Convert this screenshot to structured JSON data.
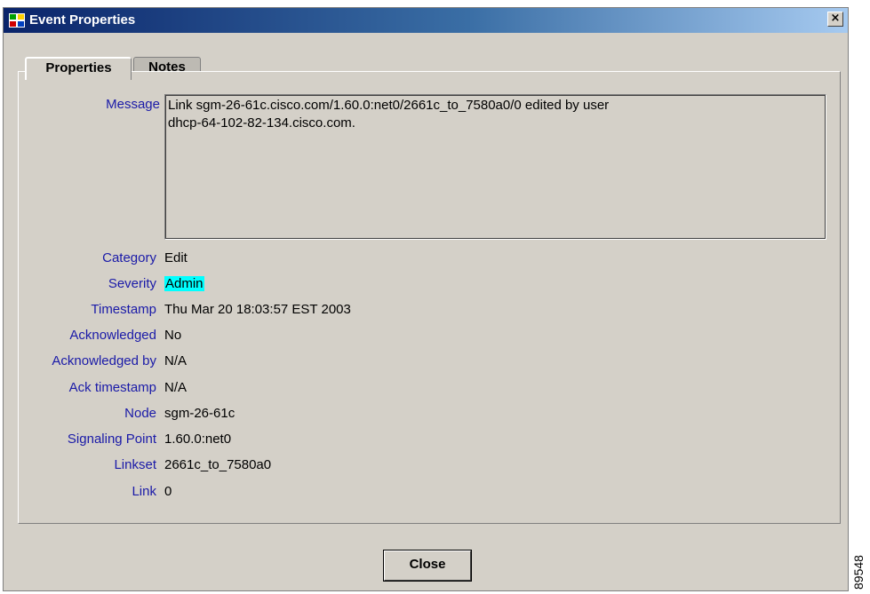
{
  "window": {
    "title": "Event Properties",
    "close_glyph": "×"
  },
  "tabs": [
    {
      "label": "Properties",
      "active": true
    },
    {
      "label": "Notes",
      "active": false
    }
  ],
  "fields": {
    "message_label": "Message",
    "message_lines": [
      "Link sgm-26-61c.cisco.com/1.60.0:net0/2661c_to_7580a0/0 edited by user",
      "dhcp-64-102-82-134.cisco.com."
    ],
    "rows": [
      {
        "label": "Category",
        "value": "Edit"
      },
      {
        "label": "Severity",
        "value": "Admin"
      },
      {
        "label": "Timestamp",
        "value": "Thu Mar 20 18:03:57 EST 2003"
      },
      {
        "label": "Acknowledged",
        "value": "No"
      },
      {
        "label": "Acknowledged by",
        "value": "N/A"
      },
      {
        "label": "Ack timestamp",
        "value": "N/A"
      },
      {
        "label": "Node",
        "value": "sgm-26-61c"
      },
      {
        "label": "Signaling Point",
        "value": "1.60.0:net0"
      },
      {
        "label": "Linkset",
        "value": "2661c_to_7580a0"
      },
      {
        "label": "Link",
        "value": "0"
      }
    ]
  },
  "buttons": {
    "close": "Close"
  },
  "figure_id": "89548",
  "colors": {
    "severity_highlight": "#00ffff",
    "label_text": "#1a1aa8",
    "title_bar": "#0a246a"
  },
  "icons": {
    "app": "network-tree-icon",
    "close": "close-icon"
  }
}
